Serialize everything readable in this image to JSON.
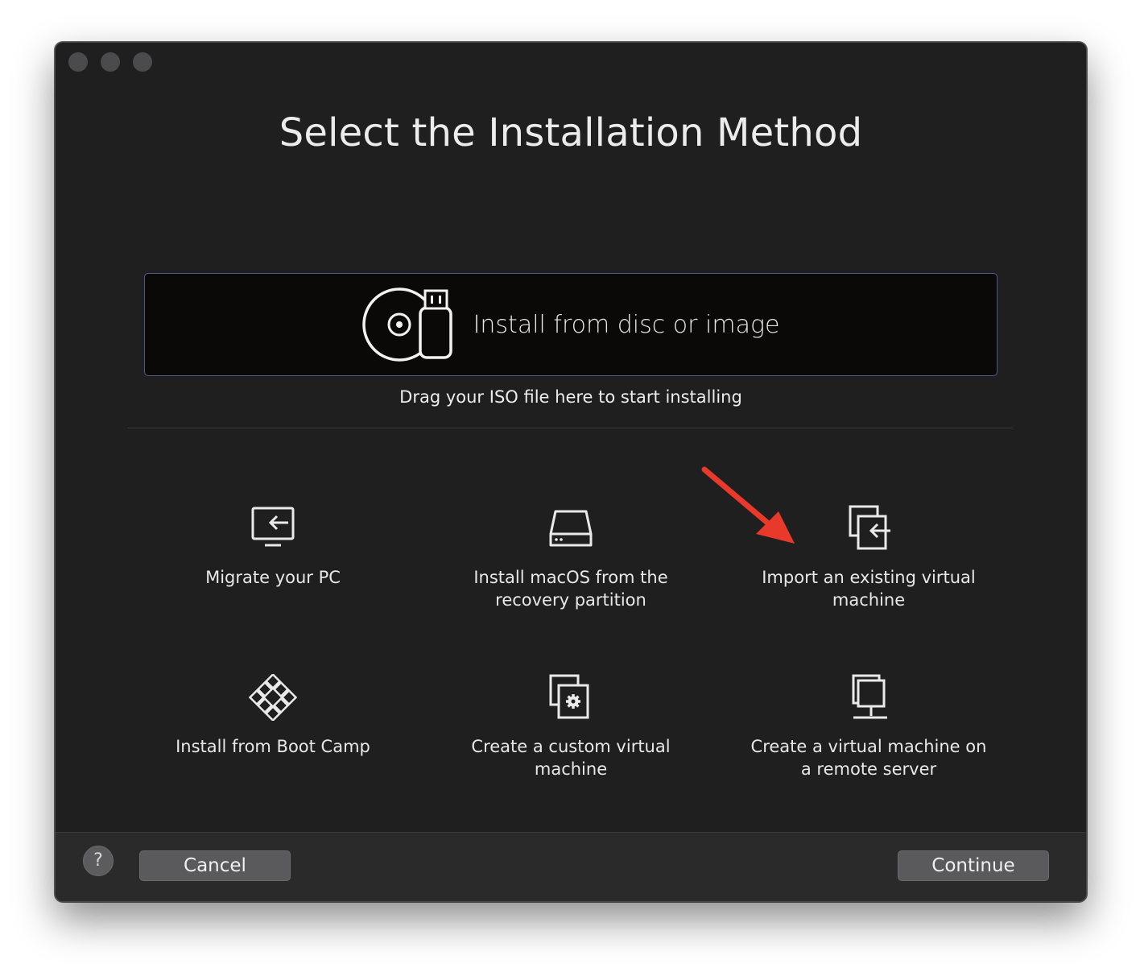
{
  "window": {
    "title": "Select the Installation Method"
  },
  "dropzone": {
    "label": "Install from disc or image",
    "icon": "disc-usb-icon",
    "hint": "Drag your ISO file here to start installing"
  },
  "options": [
    {
      "icon": "migrate-pc-icon",
      "label": "Migrate your PC"
    },
    {
      "icon": "hard-drive-icon",
      "label": "Install macOS from the recovery partition"
    },
    {
      "icon": "import-vm-icon",
      "label": "Import an existing virtual machine"
    },
    {
      "icon": "boot-camp-icon",
      "label": "Install from Boot Camp"
    },
    {
      "icon": "custom-vm-icon",
      "label": "Create a custom virtual machine"
    },
    {
      "icon": "remote-server-icon",
      "label": "Create a virtual machine on a remote server"
    }
  ],
  "annotation": {
    "color": "#e8392a",
    "points_to": "Import an existing virtual machine"
  },
  "footer": {
    "help_label": "?",
    "cancel_label": "Cancel",
    "continue_label": "Continue"
  }
}
